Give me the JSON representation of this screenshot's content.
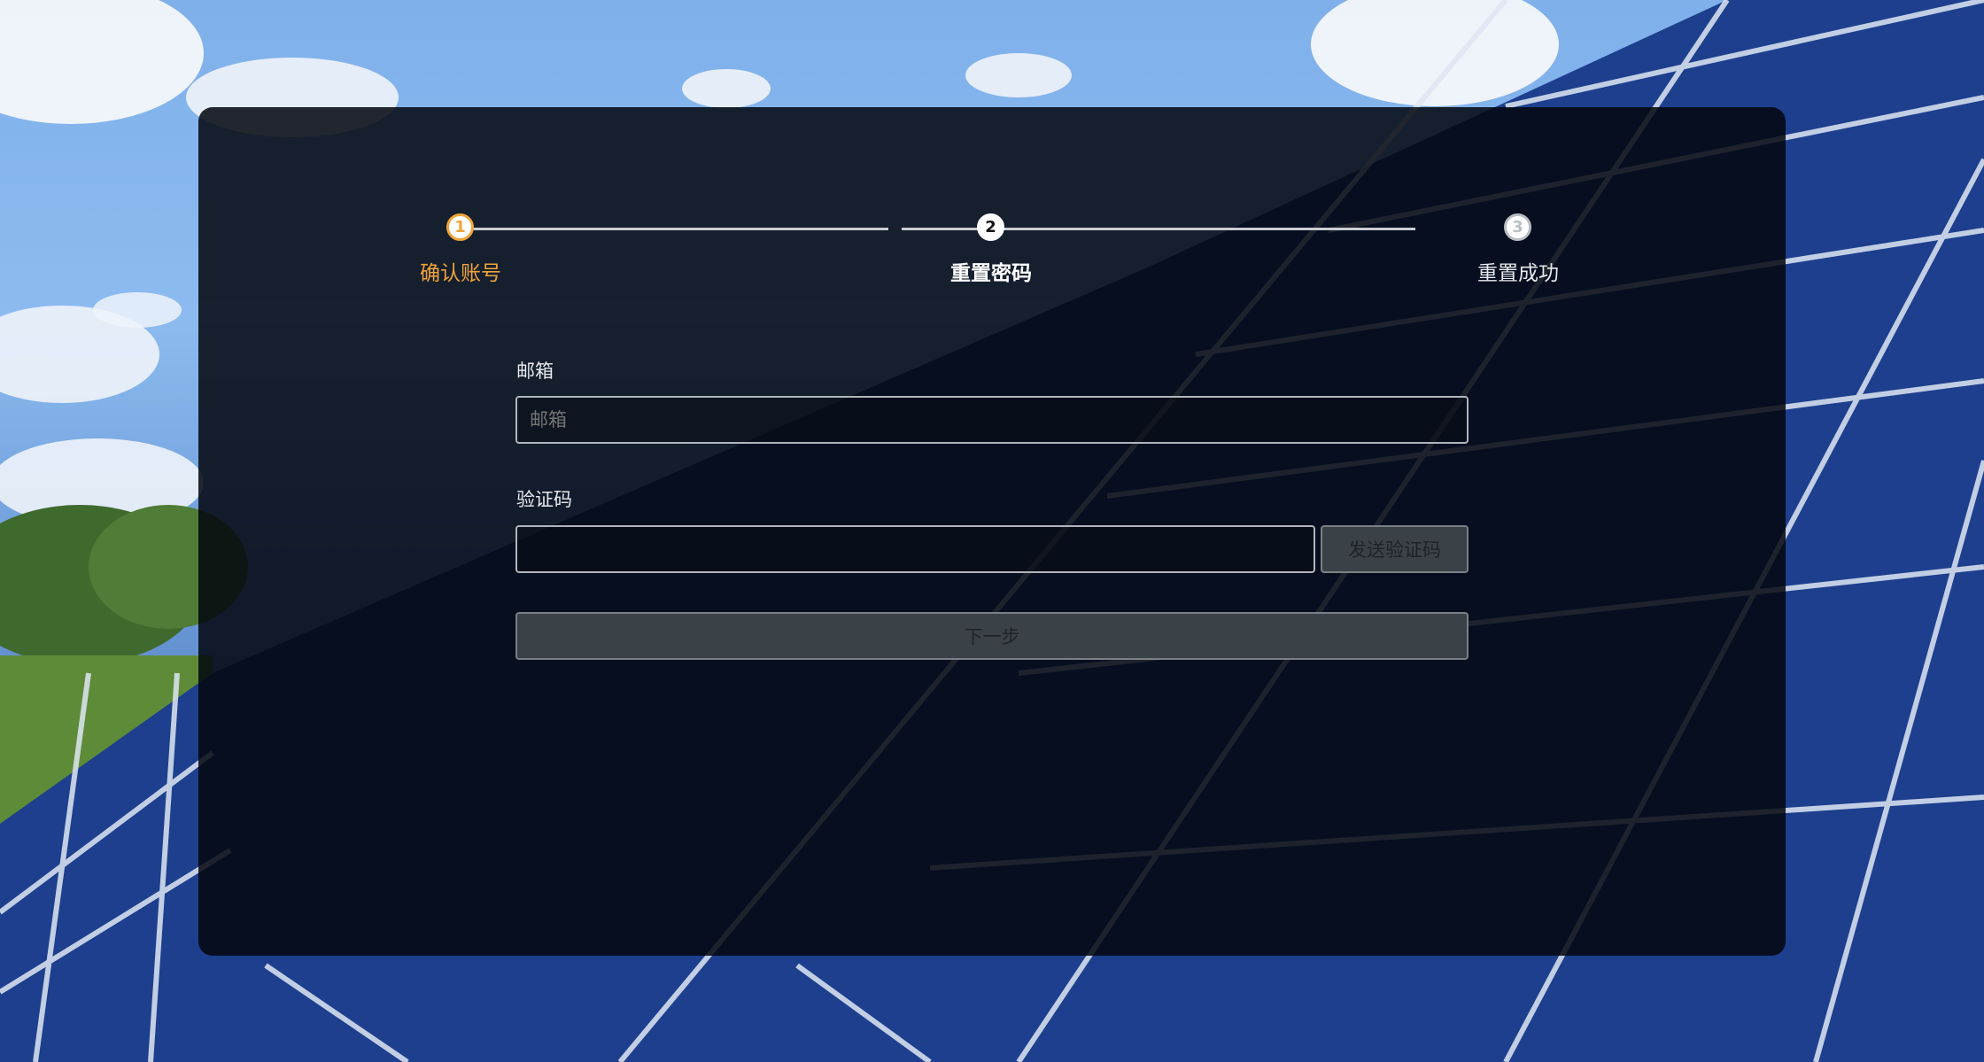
{
  "stepper": {
    "steps": [
      {
        "number": "1",
        "label": "确认账号",
        "state": "completed"
      },
      {
        "number": "2",
        "label": "重置密码",
        "state": "current"
      },
      {
        "number": "3",
        "label": "重置成功",
        "state": "pending"
      }
    ]
  },
  "form": {
    "email": {
      "label": "邮箱",
      "placeholder": "邮箱",
      "value": ""
    },
    "code": {
      "label": "验证码",
      "placeholder": "",
      "value": ""
    },
    "send_code_button": "发送验证码",
    "next_button": "下一步"
  },
  "colors": {
    "accent": "#f0a439",
    "panel": "#02060e"
  }
}
